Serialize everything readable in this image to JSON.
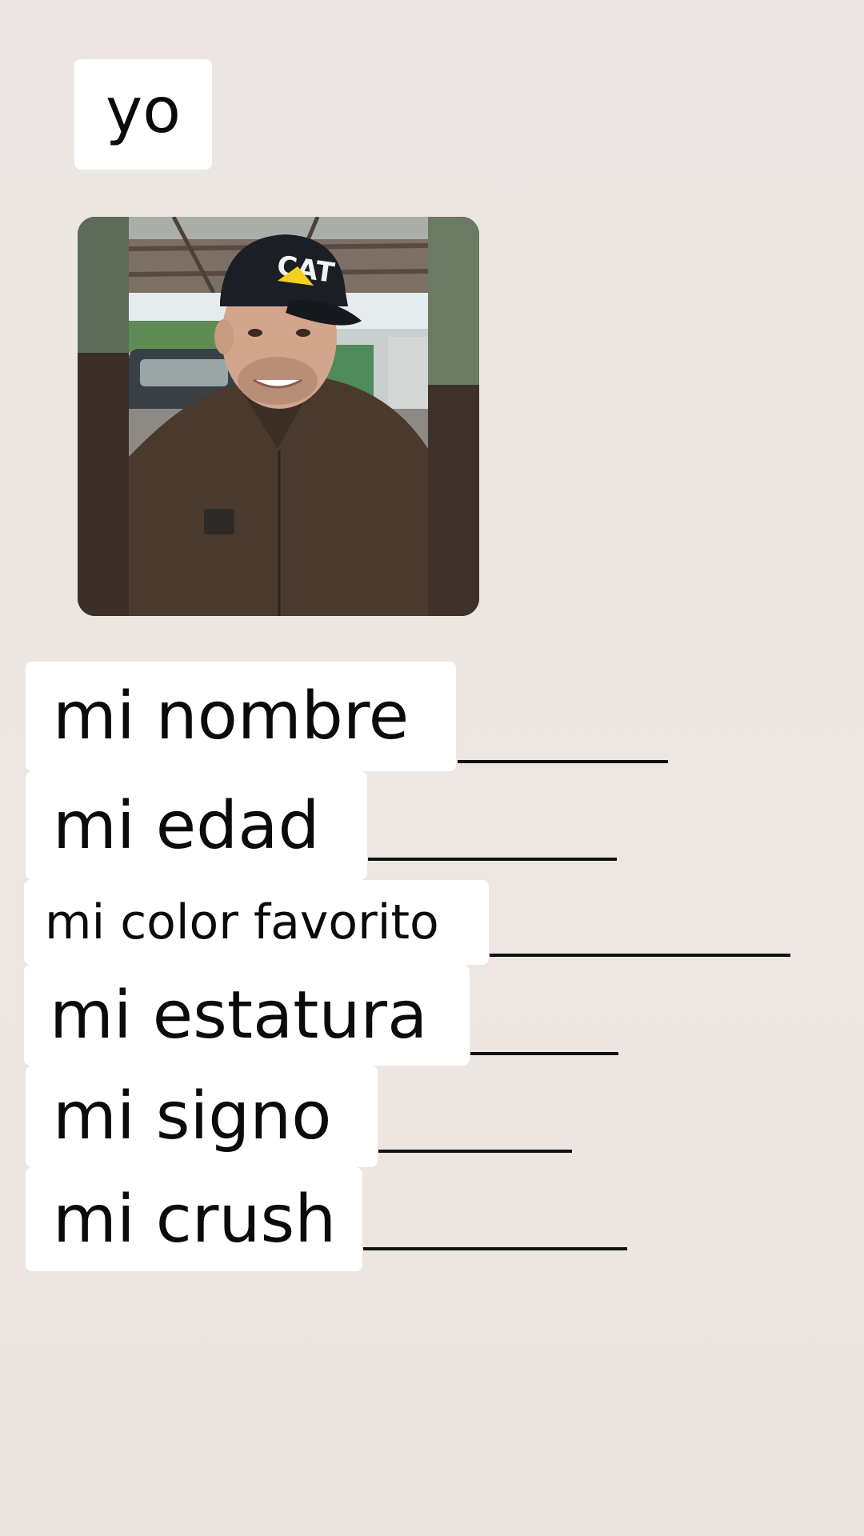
{
  "title": "yo",
  "photo": {
    "description_icon": "profile-photo",
    "cap_text": "CAT"
  },
  "fields": [
    {
      "label": "mi nombre"
    },
    {
      "label": "mi edad"
    },
    {
      "label": "mi color favorito"
    },
    {
      "label": "mi estatura"
    },
    {
      "label": "mi signo"
    },
    {
      "label": "mi crush"
    }
  ],
  "colors": {
    "background": "#ece6e2",
    "label_box": "#ffffff",
    "text": "#0b0b0b",
    "line": "#111111"
  }
}
